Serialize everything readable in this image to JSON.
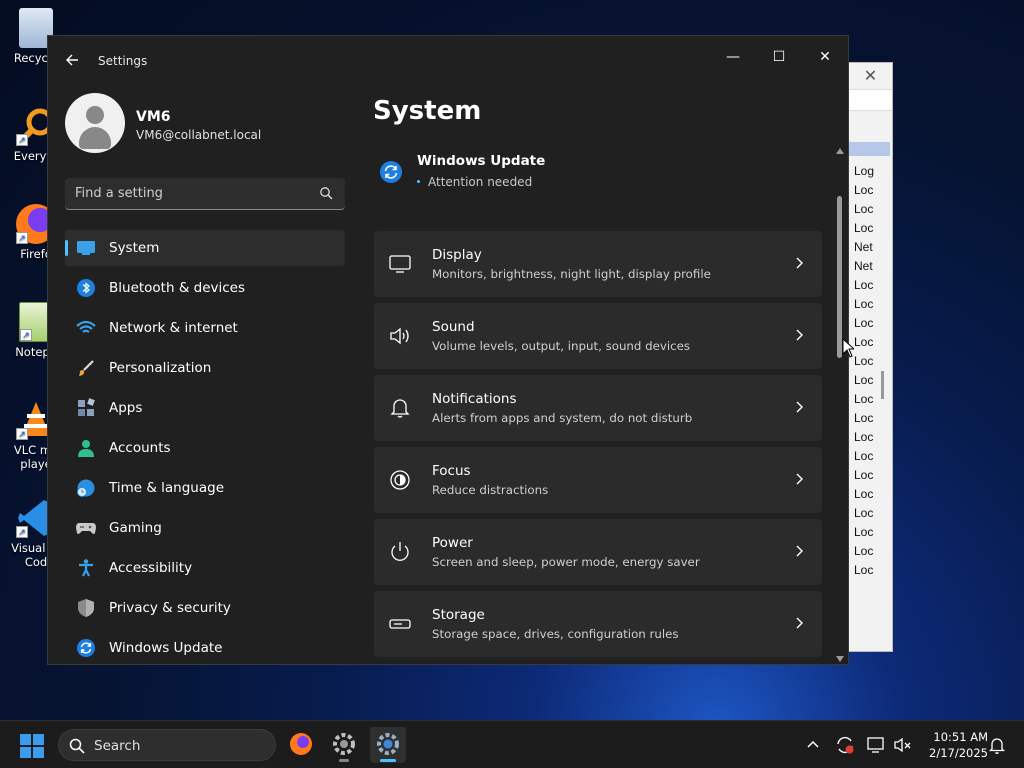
{
  "desktop": {
    "icons": [
      {
        "label": "Recycle"
      },
      {
        "label": "Everyth"
      },
      {
        "label": "Firefo"
      },
      {
        "label": "Notepa"
      },
      {
        "label": "VLC me\nplaye"
      },
      {
        "label": "Visual St\nCod"
      }
    ]
  },
  "background_window": {
    "close_symbol": "✕",
    "rows": [
      "Log",
      "Loc",
      "Loc",
      "Loc",
      "Net",
      "Net",
      "Loc",
      "Loc",
      "Loc",
      "Loc",
      "Loc",
      "Loc",
      "Loc",
      "Loc",
      "Loc",
      "Loc",
      "Loc",
      "Loc",
      "Loc",
      "Loc",
      "Loc",
      "Loc"
    ]
  },
  "settings": {
    "title": "Settings",
    "controls": {
      "minimize": "—",
      "maximize": "☐",
      "close": "✕"
    },
    "profile": {
      "name": "VM6",
      "email": "VM6@collabnet.local"
    },
    "search": {
      "placeholder": "Find a setting"
    },
    "nav": [
      {
        "label": "System",
        "icon": "system-icon",
        "active": true
      },
      {
        "label": "Bluetooth & devices",
        "icon": "bluetooth-icon"
      },
      {
        "label": "Network & internet",
        "icon": "wifi-icon"
      },
      {
        "label": "Personalization",
        "icon": "brush-icon"
      },
      {
        "label": "Apps",
        "icon": "apps-icon"
      },
      {
        "label": "Accounts",
        "icon": "accounts-icon"
      },
      {
        "label": "Time & language",
        "icon": "globe-clock-icon"
      },
      {
        "label": "Gaming",
        "icon": "gamepad-icon"
      },
      {
        "label": "Accessibility",
        "icon": "accessibility-icon"
      },
      {
        "label": "Privacy & security",
        "icon": "shield-icon"
      },
      {
        "label": "Windows Update",
        "icon": "windows-update-icon"
      }
    ],
    "main": {
      "title": "System",
      "update": {
        "title": "Windows Update",
        "status": "Attention needed"
      },
      "cards": [
        {
          "title": "Display",
          "subtitle": "Monitors, brightness, night light, display profile",
          "icon": "display-icon"
        },
        {
          "title": "Sound",
          "subtitle": "Volume levels, output, input, sound devices",
          "icon": "speaker-icon"
        },
        {
          "title": "Notifications",
          "subtitle": "Alerts from apps and system, do not disturb",
          "icon": "bell-icon"
        },
        {
          "title": "Focus",
          "subtitle": "Reduce distractions",
          "icon": "focus-icon"
        },
        {
          "title": "Power",
          "subtitle": "Screen and sleep, power mode, energy saver",
          "icon": "power-icon"
        },
        {
          "title": "Storage",
          "subtitle": "Storage space, drives, configuration rules",
          "icon": "storage-icon"
        }
      ]
    }
  },
  "taskbar": {
    "search_label": "Search",
    "time": "10:51 AM",
    "date": "2/17/2025"
  },
  "colors": {
    "accent": "#4cc2ff",
    "window_bg": "#202020",
    "card_bg": "#2b2b2b"
  }
}
